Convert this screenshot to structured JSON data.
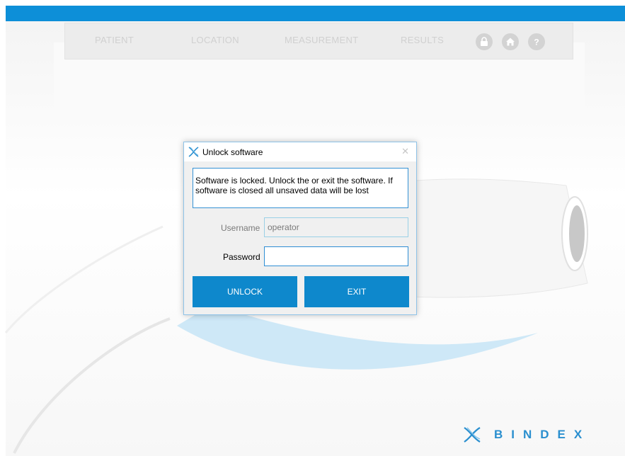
{
  "nav": {
    "items": [
      {
        "label": "PATIENT"
      },
      {
        "label": "LOCATION"
      },
      {
        "label": "MEASUREMENT"
      },
      {
        "label": "RESULTS"
      }
    ],
    "icons": [
      "lock-icon",
      "home-icon",
      "help-icon"
    ]
  },
  "dialog": {
    "title": "Unlock software",
    "message": "Software is locked. Unlock the or exit the software. If software is closed all unsaved data will be lost",
    "username_label": "Username",
    "username_value": "operator",
    "password_label": "Password",
    "password_value": "",
    "unlock_label": "UNLOCK",
    "exit_label": "EXIT"
  },
  "brand": {
    "name": "BINDEX"
  },
  "colors": {
    "accent": "#0e88cc",
    "nav_bg": "#ececec"
  }
}
